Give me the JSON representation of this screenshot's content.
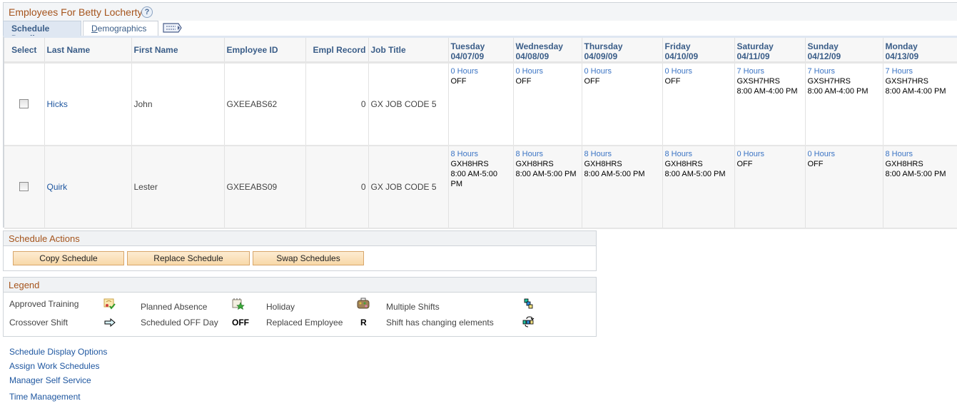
{
  "header": {
    "title": "Employees For Betty Locherty",
    "help_symbol": "?"
  },
  "tabs": [
    {
      "label": "Schedule Detail",
      "active": true
    },
    {
      "label_first": "D",
      "label_rest": "emographics",
      "active": false
    }
  ],
  "grid": {
    "columns": {
      "select": "Select",
      "last_name": "Last Name",
      "first_name": "First Name",
      "employee_id": "Employee ID",
      "empl_record": "Empl Record",
      "job_title": "Job Title"
    },
    "days": [
      {
        "day": "Tuesday",
        "date": "04/07/09"
      },
      {
        "day": "Wednesday",
        "date": "04/08/09"
      },
      {
        "day": "Thursday",
        "date": "04/09/09"
      },
      {
        "day": "Friday",
        "date": "04/10/09"
      },
      {
        "day": "Saturday",
        "date": "04/11/09"
      },
      {
        "day": "Sunday",
        "date": "04/12/09"
      },
      {
        "day": "Monday",
        "date": "04/13/09"
      }
    ],
    "rows": [
      {
        "selected": false,
        "last_name": "Hicks",
        "first_name": "John",
        "employee_id": "GXEEABS62",
        "empl_record": "0",
        "job_title": "GX JOB CODE 5",
        "schedule": [
          {
            "hours": "0 Hours",
            "shift": "OFF",
            "time": ""
          },
          {
            "hours": "0 Hours",
            "shift": "OFF",
            "time": ""
          },
          {
            "hours": "0 Hours",
            "shift": "OFF",
            "time": ""
          },
          {
            "hours": "0 Hours",
            "shift": "OFF",
            "time": ""
          },
          {
            "hours": "7 Hours",
            "shift": "GXSH7HRS",
            "time": "8:00 AM-4:00 PM"
          },
          {
            "hours": "7 Hours",
            "shift": "GXSH7HRS",
            "time": "8:00 AM-4:00 PM"
          },
          {
            "hours": "7 Hours",
            "shift": "GXSH7HRS",
            "time": "8:00 AM-4:00 PM"
          }
        ]
      },
      {
        "selected": false,
        "last_name": "Quirk",
        "first_name": "Lester",
        "employee_id": "GXEEABS09",
        "empl_record": "0",
        "job_title": "GX JOB CODE 5",
        "schedule": [
          {
            "hours": "8 Hours",
            "shift": "GXH8HRS",
            "time": "8:00 AM-5:00 PM"
          },
          {
            "hours": "8 Hours",
            "shift": "GXH8HRS",
            "time": "8:00 AM-5:00 PM"
          },
          {
            "hours": "8 Hours",
            "shift": "GXH8HRS",
            "time": "8:00 AM-5:00 PM"
          },
          {
            "hours": "8 Hours",
            "shift": "GXH8HRS",
            "time": "8:00 AM-5:00 PM"
          },
          {
            "hours": "0 Hours",
            "shift": "OFF",
            "time": ""
          },
          {
            "hours": "0 Hours",
            "shift": "OFF",
            "time": ""
          },
          {
            "hours": "8 Hours",
            "shift": "GXH8HRS",
            "time": "8:00 AM-5:00 PM"
          }
        ]
      }
    ]
  },
  "schedule_actions": {
    "title": "Schedule Actions",
    "buttons": [
      "Copy Schedule",
      "Replace Schedule",
      "Swap Schedules"
    ]
  },
  "legend": {
    "title": "Legend",
    "items": [
      {
        "label": "Approved Training",
        "icon": "approved-training-icon"
      },
      {
        "label": "Planned Absence",
        "icon": "planned-absence-icon"
      },
      {
        "label": "Holiday",
        "icon": "holiday-icon"
      },
      {
        "label": "Multiple Shifts",
        "icon": "multiple-shifts-icon"
      },
      {
        "label": "Crossover Shift",
        "icon": "crossover-arrow-icon"
      },
      {
        "label": "Scheduled OFF Day",
        "symbol": "OFF"
      },
      {
        "label": "Replaced Employee",
        "symbol": "R"
      },
      {
        "label": "Shift has changing elements",
        "icon": "changing-elements-icon"
      }
    ]
  },
  "links": [
    "Schedule Display Options",
    "Assign Work Schedules",
    "Manager Self Service",
    "Time Management"
  ],
  "colors": {
    "title_orange": "#a5541c",
    "link_blue": "#1f57a0",
    "header_blue": "#3a5d88",
    "button_fill": "#f8d8a8"
  }
}
